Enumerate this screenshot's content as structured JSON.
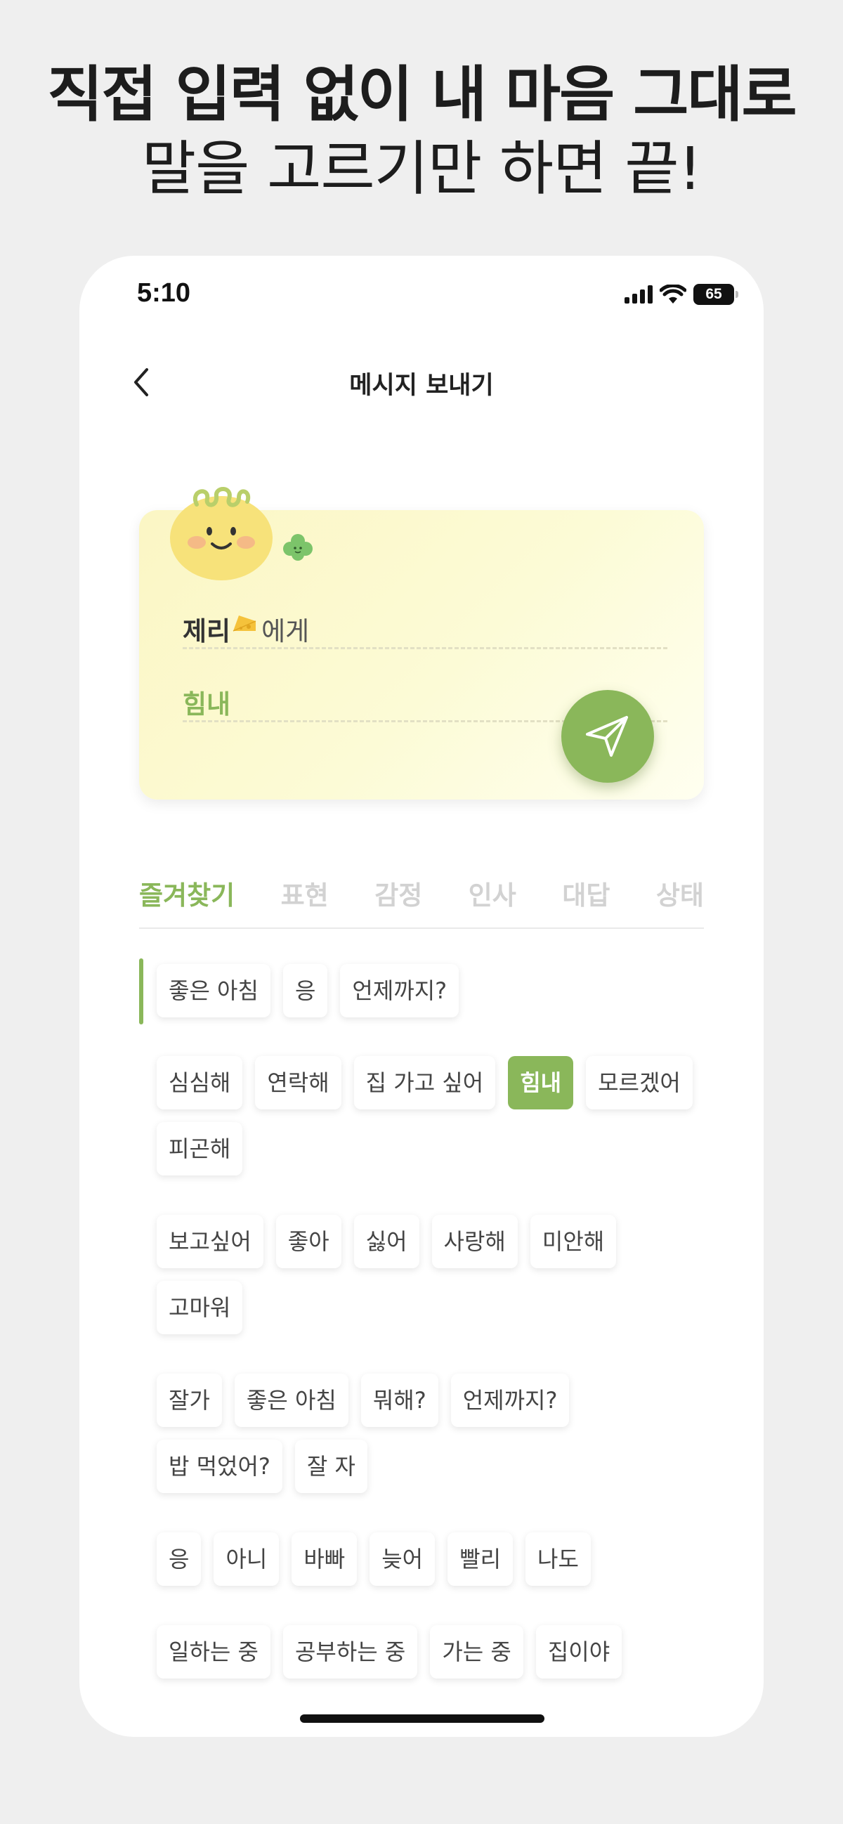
{
  "headline": {
    "line1": "직접 입력 없이 내 마음 그대로",
    "line2": "말을 고르기만 하면 끝!"
  },
  "status_bar": {
    "time": "5:10",
    "battery": "65"
  },
  "nav": {
    "title": "메시지 보내기"
  },
  "card": {
    "recipient_name": "제리",
    "recipient_suffix": "에게",
    "message": "힘내"
  },
  "tabs": [
    {
      "label": "즐겨찾기",
      "active": true
    },
    {
      "label": "표현",
      "active": false
    },
    {
      "label": "감정",
      "active": false
    },
    {
      "label": "인사",
      "active": false
    },
    {
      "label": "대답",
      "active": false
    },
    {
      "label": "상태",
      "active": false
    }
  ],
  "favorites": [
    "좋은 아침",
    "응",
    "언제까지?"
  ],
  "groups": [
    {
      "chips": [
        "심심해",
        "연락해",
        "집 가고 싶어",
        "힘내",
        "모르겠어",
        "피곤해"
      ],
      "selected": "힘내"
    },
    {
      "chips": [
        "보고싶어",
        "좋아",
        "싫어",
        "사랑해",
        "미안해",
        "고마워"
      ]
    },
    {
      "chips": [
        "잘가",
        "좋은 아침",
        "뭐해?",
        "언제까지?",
        "밥 먹었어?",
        "잘 자"
      ]
    },
    {
      "chips": [
        "응",
        "아니",
        "바빠",
        "늦어",
        "빨리",
        "나도"
      ]
    },
    {
      "chips": [
        "일하는 중",
        "공부하는 중",
        "가는 중",
        "집이야"
      ]
    }
  ],
  "colors": {
    "accent": "#8ab75a",
    "card_bg": "#fbf6c4",
    "background": "#efefef"
  },
  "icons": [
    "back-chevron-icon",
    "signal-icon",
    "wifi-icon",
    "battery-icon",
    "mascot-icon",
    "clover-icon",
    "cheese-icon",
    "send-icon"
  ]
}
